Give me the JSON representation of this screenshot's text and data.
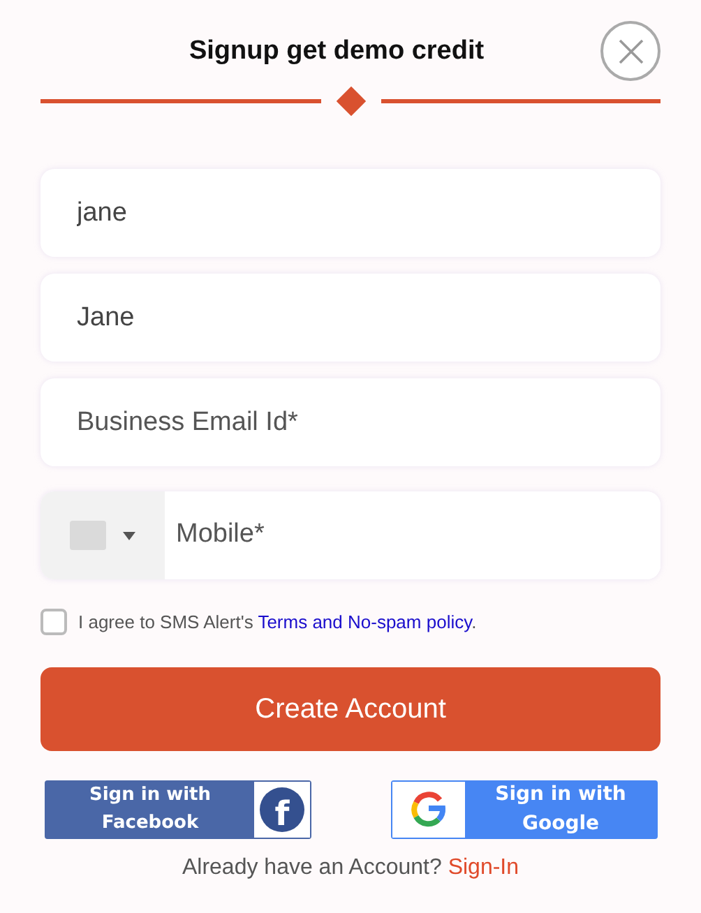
{
  "title": "Signup get demo credit",
  "fields": [
    {
      "kind": "text",
      "value": "jane"
    },
    {
      "kind": "text",
      "value": "Jane"
    },
    {
      "kind": "text",
      "placeholder": "Business Email Id*"
    },
    {
      "kind": "phone",
      "placeholder": "Mobile*"
    }
  ],
  "agreement": {
    "checked": false,
    "text": "I agree to SMS Alert's",
    "link": "Terms and No-spam policy",
    "end": "."
  },
  "submit": "Create Account",
  "social": [
    {
      "kind": "facebook",
      "label": "Sign in with Facebook",
      "glyph": "f"
    },
    {
      "kind": "google",
      "label": "Sign in with Google"
    }
  ],
  "footer": {
    "text": "Already have an Account?",
    "link": "Sign-In"
  }
}
